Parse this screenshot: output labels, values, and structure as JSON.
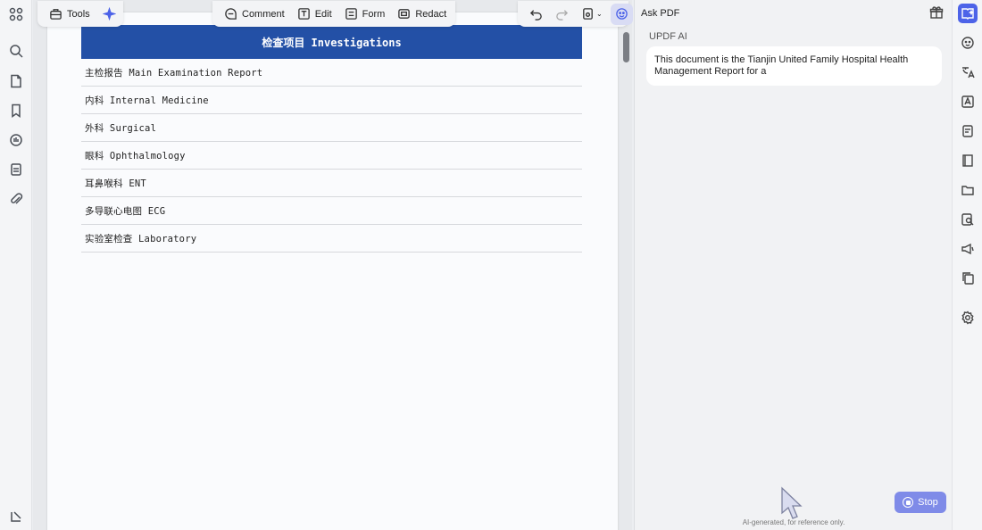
{
  "toolbar": {
    "tools_label": "Tools",
    "comment_label": "Comment",
    "edit_label": "Edit",
    "form_label": "Form",
    "redact_label": "Redact"
  },
  "document": {
    "header": "检查项目 Investigations",
    "rows": [
      "主检报告 Main Examination Report",
      "内科 Internal Medicine",
      "外科 Surgical",
      "眼科 Ophthalmology",
      "耳鼻喉科 ENT",
      "多导联心电图 ECG",
      "实验室检查 Laboratory"
    ]
  },
  "ai_panel": {
    "title": "Ask PDF",
    "sender": "UPDF AI",
    "message": "This document is the Tianjin United Family Hospital Health Management Report for a",
    "stop_label": "Stop",
    "disclaimer": "AI-generated, for reference only."
  },
  "colors": {
    "doc_header_bg": "#2350a6",
    "accent": "#4d63e8",
    "stop_button": "#7f8be8"
  }
}
